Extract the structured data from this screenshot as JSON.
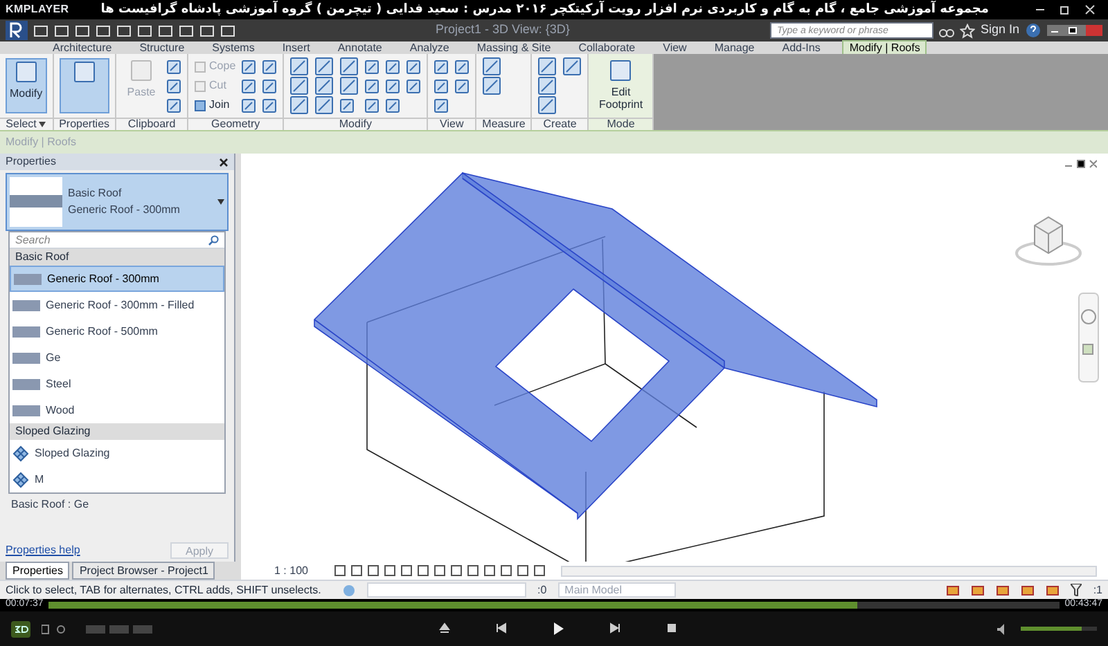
{
  "player": {
    "logo": "KMPLAYER",
    "title": "مجموعه آموزشی جامع ، گام به گام و کاربردی نرم افزار رویت آرکیتکچر ۲۰۱۶   مدرس : سعید فدایی ( تیچرمن ) گروه آموزشی پادشاه گرافیست ها"
  },
  "app": {
    "window_title": "Project1 - 3D View: {3D}",
    "search": {
      "placeholder": "Type a keyword or phrase"
    },
    "sign_in": "Sign In"
  },
  "ribbon_tabs": [
    {
      "label": "Architecture",
      "selected": false
    },
    {
      "label": "Structure",
      "selected": false
    },
    {
      "label": "Systems",
      "selected": false
    },
    {
      "label": "Insert",
      "selected": false
    },
    {
      "label": "Annotate",
      "selected": false
    },
    {
      "label": "Analyze",
      "selected": false
    },
    {
      "label": "Massing & Site",
      "selected": false
    },
    {
      "label": "Collaborate",
      "selected": false
    },
    {
      "label": "View",
      "selected": false
    },
    {
      "label": "Manage",
      "selected": false
    },
    {
      "label": "Add-Ins",
      "selected": false
    },
    {
      "label": "Modify | Roofs",
      "selected": true
    }
  ],
  "ribbon_panels": [
    {
      "label": "Select",
      "dropdown": true,
      "tools": [
        {
          "kind": "large",
          "label": "Modify",
          "selected": true
        }
      ]
    },
    {
      "label": "Properties",
      "dropdown": false,
      "tools": [
        {
          "kind": "large",
          "selected": true
        }
      ]
    },
    {
      "label": "Clipboard",
      "dropdown": false,
      "tools": [
        {
          "kind": "large",
          "label": "Paste",
          "selected": false,
          "disabled": true
        },
        {
          "kind": "icon"
        },
        {
          "kind": "icon"
        },
        {
          "kind": "icon"
        }
      ]
    },
    {
      "label": "Geometry",
      "dropdown": false,
      "tools": [
        {
          "kind": "small",
          "label": "Cope",
          "disabled": true
        },
        {
          "kind": "small",
          "label": "Cut",
          "disabled": true
        },
        {
          "kind": "small",
          "label": "Join",
          "disabled": false
        },
        {
          "kind": "icon"
        },
        {
          "kind": "icon"
        },
        {
          "kind": "icon"
        },
        {
          "kind": "icon"
        },
        {
          "kind": "icon"
        },
        {
          "kind": "icon"
        }
      ]
    },
    {
      "label": "Modify",
      "dropdown": false,
      "tools": [
        {
          "kind": "bigicon"
        },
        {
          "kind": "bigicon"
        },
        {
          "kind": "bigicon"
        },
        {
          "kind": "bigicon"
        },
        {
          "kind": "bigicon"
        },
        {
          "kind": "bigicon"
        },
        {
          "kind": "bigicon"
        },
        {
          "kind": "bigicon"
        },
        {
          "kind": "icon"
        },
        {
          "kind": "icon"
        },
        {
          "kind": "icon"
        },
        {
          "kind": "icon"
        },
        {
          "kind": "icon"
        },
        {
          "kind": "icon"
        },
        {
          "kind": "icon"
        },
        {
          "kind": "icon"
        },
        {
          "kind": "icon"
        }
      ]
    },
    {
      "label": "View",
      "dropdown": false,
      "tools": [
        {
          "kind": "icon"
        },
        {
          "kind": "icon"
        },
        {
          "kind": "icon"
        },
        {
          "kind": "icon"
        },
        {
          "kind": "icon"
        }
      ]
    },
    {
      "label": "Measure",
      "dropdown": false,
      "tools": [
        {
          "kind": "bigicon"
        },
        {
          "kind": "bigicon"
        }
      ]
    },
    {
      "label": "Create",
      "dropdown": false,
      "tools": [
        {
          "kind": "bigicon"
        },
        {
          "kind": "bigicon"
        },
        {
          "kind": "bigicon"
        },
        {
          "kind": "bigicon"
        }
      ]
    },
    {
      "label": "Mode",
      "dropdown": false,
      "tools": [
        {
          "kind": "large",
          "label": "Edit Footprint",
          "selected": false
        }
      ]
    }
  ],
  "options_bar": "Modify | Roofs",
  "properties": {
    "title": "Properties",
    "type_family": "Basic Roof",
    "type_name": "Generic Roof - 300mm",
    "dropdown": {
      "search": {
        "placeholder": "Search"
      },
      "groups": [
        {
          "label": "Basic Roof",
          "items": [
            {
              "label": "Generic Roof - 300mm",
              "selected": true
            },
            {
              "label": "Generic Roof - 300mm - Filled",
              "selected": false
            },
            {
              "label": "Generic Roof - 500mm",
              "selected": false
            },
            {
              "label": "Ge",
              "selected": false
            },
            {
              "label": "Steel",
              "selected": false
            },
            {
              "label": "Wood",
              "selected": false
            }
          ]
        },
        {
          "label": "Sloped Glazing",
          "items": [
            {
              "label": "Sloped Glazing",
              "selected": false
            },
            {
              "label": "M",
              "selected": false
            }
          ]
        }
      ]
    },
    "instance": "Basic Roof : Ge",
    "help_link": "Properties help",
    "apply": "Apply"
  },
  "panel_tabs": [
    {
      "label": "Properties",
      "selected": true
    },
    {
      "label": "Project Browser - Project1",
      "selected": false
    }
  ],
  "view": {
    "scale": "1 : 100"
  },
  "status_bar": {
    "message": "Click to select, TAB for alternates, CTRL adds, SHIFT unselects.",
    "worksets": ":0",
    "model": "Main Model",
    "filter_count": ":1"
  },
  "playback": {
    "elapsed": "00:07:37",
    "total": "00:43:47",
    "level": 0.8,
    "volume": {
      "level": 0.8
    }
  }
}
